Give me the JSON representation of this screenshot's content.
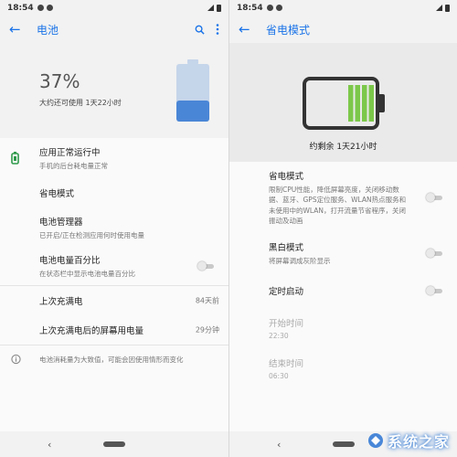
{
  "left": {
    "status": {
      "time": "18:54"
    },
    "appbar": {
      "title": "电池"
    },
    "battery": {
      "percent": "37%",
      "level": 0.37,
      "remaining": "大约还可使用 1天22小时"
    },
    "items": [
      {
        "title": "应用正常运行中",
        "subtitle": "手机的后台耗电量正常"
      },
      {
        "title": "省电模式"
      },
      {
        "title": "电池管理器",
        "subtitle": "已开启/正在检测应用何时使用电量"
      },
      {
        "title": "电池电量百分比",
        "subtitle": "在状态栏中显示电池电量百分比",
        "toggle_on": false
      },
      {
        "title": "上次充满电",
        "value": "84天前"
      },
      {
        "title": "上次充满电后的屏幕用电量",
        "value": "29分钟"
      }
    ],
    "footer": {
      "text": "电池消耗量为大致值，可能会因使用情形而变化"
    }
  },
  "right": {
    "status": {
      "time": "18:54"
    },
    "appbar": {
      "title": "省电模式"
    },
    "hero": {
      "remaining": "约剩余 1天21小时"
    },
    "items": [
      {
        "title": "省电模式",
        "subtitle": "限制CPU性能，降低屏幕亮度，关闭移动数据、蓝牙、GPS定位服务、WLAN热点服务和未使用中的WLAN，打开流量节省程序，关闭振动及动画",
        "toggle_on": false
      },
      {
        "title": "黑白模式",
        "subtitle": "将屏幕调成灰阶显示",
        "toggle_on": false
      },
      {
        "title": "定时启动",
        "toggle_on": false
      },
      {
        "title": "开始时间",
        "value": "22:30"
      },
      {
        "title": "结束时间",
        "value": "06:30"
      }
    ]
  },
  "watermark": {
    "text": "系统之家"
  },
  "colors": {
    "accent": "#1a73e8",
    "battery_blue": "#4a86d6",
    "battery_green": "#7cc84a",
    "status_green": "#2e9a4a"
  }
}
